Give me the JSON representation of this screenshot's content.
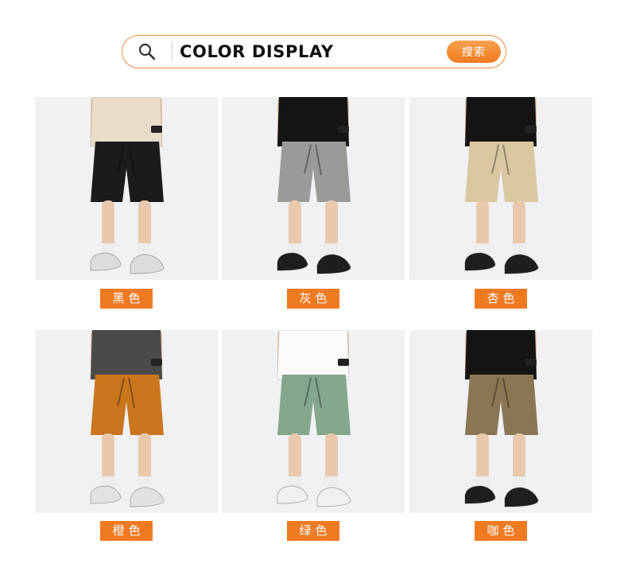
{
  "search": {
    "title": "COLOR DISPLAY",
    "button_label": "搜索",
    "icon": "search-icon",
    "accent_color": "#f07a22"
  },
  "swatches": [
    {
      "label": "黑色",
      "shorts_color": "#1b1b1b",
      "shirt_color": "#e9dcc8",
      "shoe_color": "#dcdcdc"
    },
    {
      "label": "灰色",
      "shorts_color": "#9a9a98",
      "shirt_color": "#141414",
      "shoe_color": "#1e1e1e"
    },
    {
      "label": "杏色",
      "shorts_color": "#d9c7a2",
      "shirt_color": "#141414",
      "shoe_color": "#1e1e1e"
    },
    {
      "label": "橙色",
      "shorts_color": "#c9761f",
      "shirt_color": "#4a4a4a",
      "shoe_color": "#e2e2e2"
    },
    {
      "label": "绿色",
      "shorts_color": "#86a78d",
      "shirt_color": "#fafafa",
      "shoe_color": "#f0f0f0"
    },
    {
      "label": "咖色",
      "shorts_color": "#8a7655",
      "shirt_color": "#141414",
      "shoe_color": "#1e1e1e"
    }
  ]
}
